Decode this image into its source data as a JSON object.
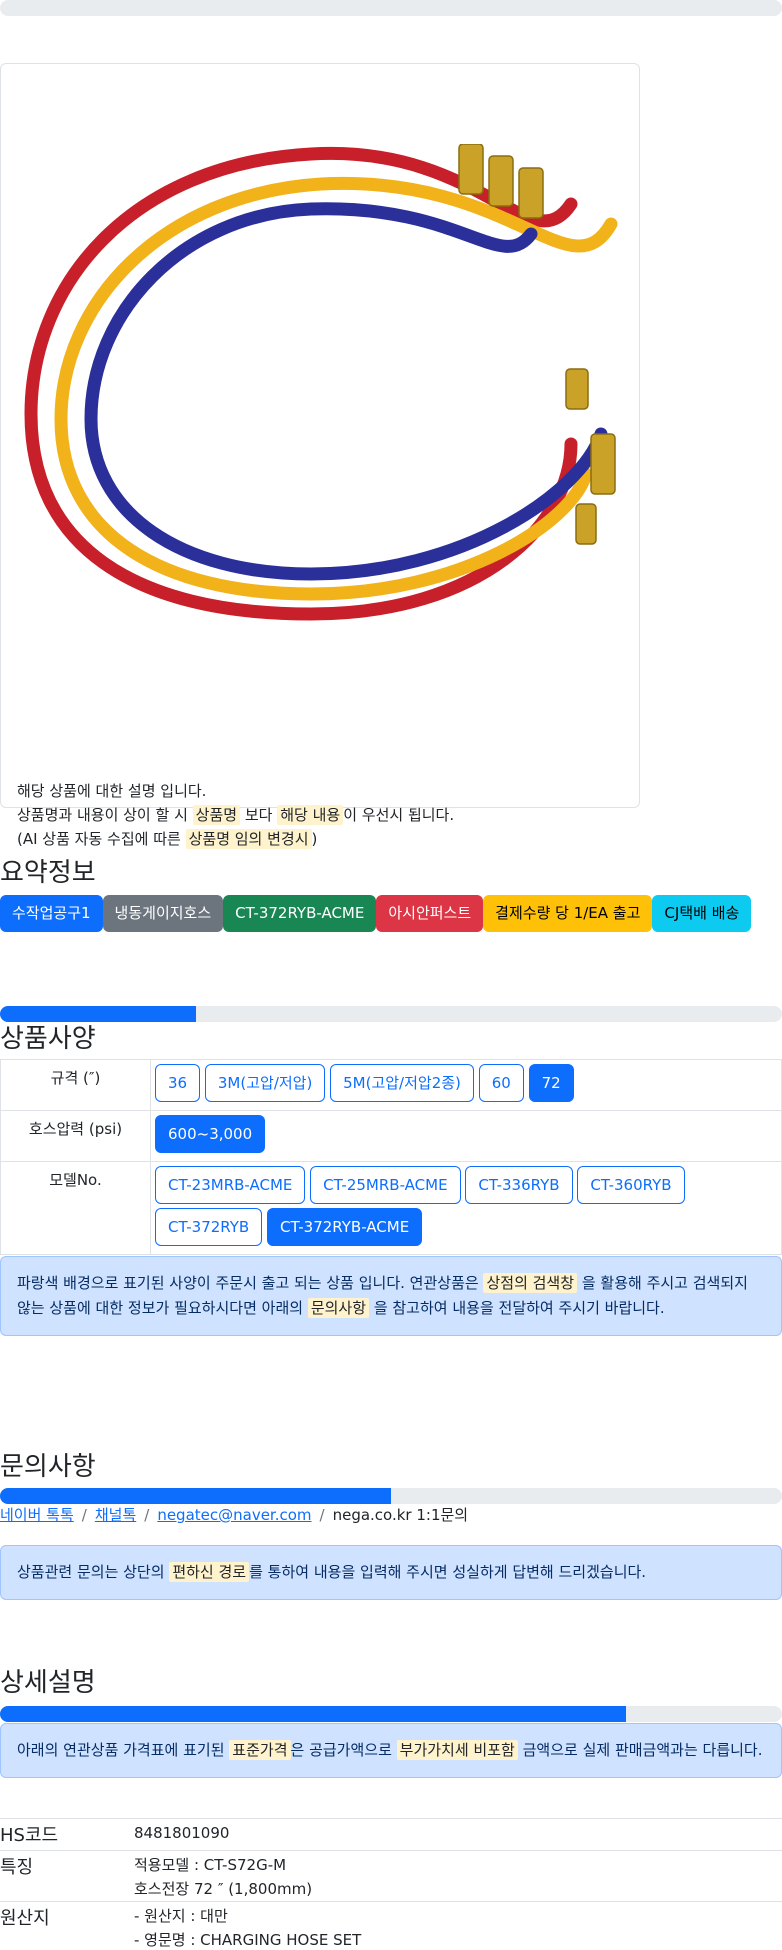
{
  "product_card": {
    "image_alt": "냉동게이지호스 CT-372RYB-ACME 적색/황색/청색 호스",
    "notice_line1": "해당 상품에 대한 설명 입니다.",
    "notice_line2_a": "상품명과 내용이 상이 할 시",
    "notice_line2_h1": "상품명",
    "notice_line2_b": "보다",
    "notice_line2_h2": "해당 내용",
    "notice_line2_c": "이 우선시 됩니다.",
    "notice_line3_a": "(AI 상품 자동 수집에 따른",
    "notice_line3_h": "상품명 임의 변경시",
    "notice_line3_b": ")"
  },
  "summary": {
    "title": "요약정보",
    "badges": [
      "수작업공구1",
      "냉동게이지호스",
      "CT-372RYB-ACME",
      "아시안퍼스트",
      "결제수량 당 1/EA 출고",
      "CJ택배 배송"
    ]
  },
  "spec": {
    "progress": 0.25,
    "title": "상품사양",
    "rows": [
      {
        "label": "규격 (″)",
        "options": [
          "36",
          "3M(고압/저압)",
          "5M(고압/저압2종)",
          "60",
          "72"
        ],
        "active": 4
      },
      {
        "label": "호스압력 (psi)",
        "options": [
          "600~3,000"
        ],
        "active": 0
      },
      {
        "label": "모델No.",
        "options": [
          "CT-23MRB-ACME",
          "CT-25MRB-ACME",
          "CT-336RYB",
          "CT-360RYB",
          "CT-372RYB",
          "CT-372RYB-ACME"
        ],
        "active": 5
      }
    ],
    "alert_a": "파랑색 배경으로 표기된 사양이 주문시 출고 되는 상품 입니다. 연관상품은",
    "alert_h1": "상점의 검색창",
    "alert_b": "을 활용해 주시고 검색되지 않는 상품에 대한 정보가 필요하시다면 아래의",
    "alert_h2": "문의사항",
    "alert_c": "을 참고하여 내용을 전달하여 주시기 바랍니다."
  },
  "inquiry": {
    "title": "문의사항",
    "progress": 0.5,
    "links": [
      "네이버 톡톡",
      "채널톡",
      "negatec@naver.com"
    ],
    "plain": "nega.co.kr 1:1문의",
    "alert_a": "상품관련 문의는 상단의",
    "alert_h": "편하신 경로",
    "alert_b": "를 통하여 내용을 입력해 주시면 성실하게 답변해 드리겠습니다."
  },
  "detail": {
    "title": "상세설명",
    "progress": 0.8,
    "alert_a": "아래의 연관상품 가격표에 표기된",
    "alert_h1": "표준가격",
    "alert_b": "은 공급가액으로",
    "alert_h2": "부가가치세 비포함",
    "alert_c": "금액으로 실제 판매금액과는 다릅니다.",
    "rows": [
      {
        "key": "HS코드",
        "lines": [
          "8481801090"
        ]
      },
      {
        "key": "특징",
        "lines": [
          "적용모델 : CT-S72G-M",
          "호스전장 72 ″ (1,800mm)"
        ]
      },
      {
        "key": "원산지",
        "lines": [
          "- 원산지 : 대만",
          "- 영문명 : CHARGING HOSE SET"
        ]
      }
    ]
  },
  "colors": {
    "primary": "#0d6efd",
    "secondary": "#6c757d",
    "success": "#198754",
    "danger": "#dc3545",
    "warning": "#ffc107",
    "info": "#0dcaf0",
    "alert_bg": "#cfe2ff",
    "highlight": "#fff3cd"
  }
}
